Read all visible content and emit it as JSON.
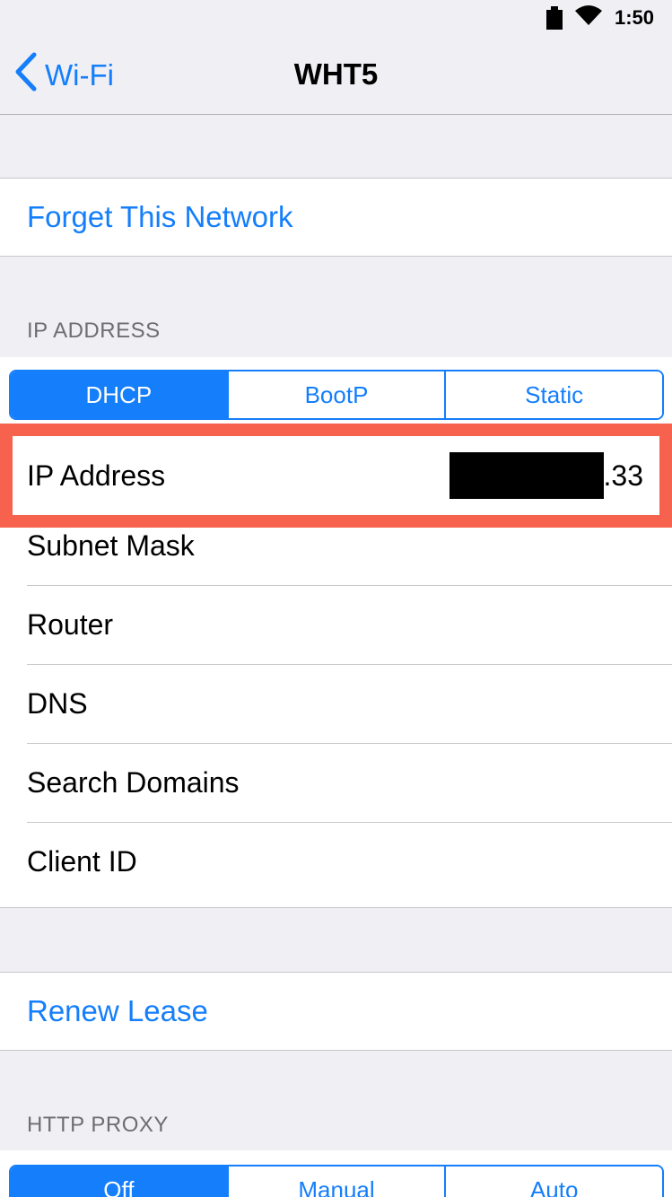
{
  "status_bar": {
    "time": "1:50",
    "icons": [
      "battery-icon",
      "wifi-icon"
    ]
  },
  "nav": {
    "back_label": "Wi-Fi",
    "title": "WHT5"
  },
  "forget_network": "Forget This Network",
  "ip_section": {
    "header": "IP ADDRESS",
    "segments": [
      {
        "label": "DHCP",
        "selected": true
      },
      {
        "label": "BootP",
        "selected": false
      },
      {
        "label": "Static",
        "selected": false
      }
    ],
    "rows": [
      {
        "label": "IP Address",
        "value_suffix": ".33",
        "value_redacted": true
      },
      {
        "label": "Subnet Mask"
      },
      {
        "label": "Router"
      },
      {
        "label": "DNS"
      },
      {
        "label": "Search Domains"
      },
      {
        "label": "Client ID"
      }
    ]
  },
  "renew_lease": "Renew Lease",
  "http_proxy": {
    "header": "HTTP PROXY",
    "segments": [
      {
        "label": "Off",
        "selected": true
      },
      {
        "label": "Manual",
        "selected": false
      },
      {
        "label": "Auto",
        "selected": false
      }
    ]
  },
  "colors": {
    "accent": "#147efb",
    "highlight": "#f7624f",
    "background": "#efeff4"
  }
}
